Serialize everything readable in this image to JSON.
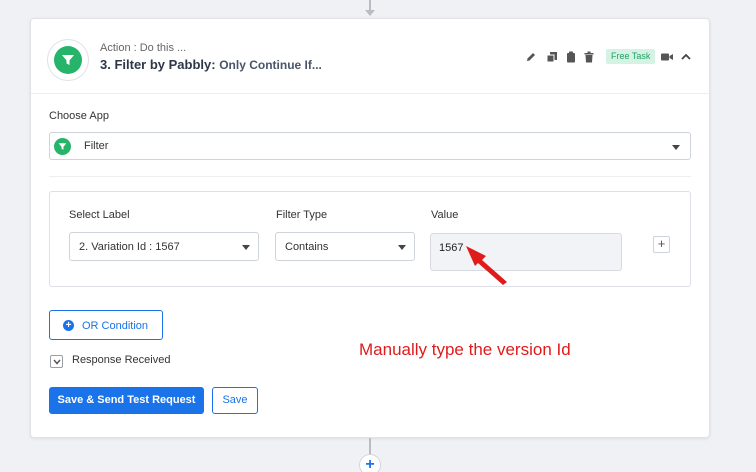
{
  "header": {
    "action_label": "Action : Do this ...",
    "step_title": "3. Filter by Pabbly:",
    "step_subtitle": "Only Continue If...",
    "badge": "Free Task",
    "icons": [
      "pencil-icon",
      "copy-icon",
      "clipboard-icon",
      "trash-icon",
      "video-icon",
      "chevron-up-icon"
    ]
  },
  "choose_app": {
    "label": "Choose App",
    "value": "Filter",
    "icon": "filter-icon"
  },
  "filter": {
    "select_label_heading": "Select Label",
    "select_label_value": "2. Variation Id : 1567",
    "filter_type_heading": "Filter Type",
    "filter_type_value": "Contains",
    "value_heading": "Value",
    "value_text": "1567",
    "add_button": "+"
  },
  "or_condition": {
    "label": "OR Condition"
  },
  "response": {
    "label": "Response Received"
  },
  "buttons": {
    "save_send": "Save & Send Test Request",
    "save": "Save"
  },
  "annotation": {
    "text": "Manually type the version Id",
    "color": "#e01b1b"
  },
  "colors": {
    "accent": "#1a73e8",
    "app_green": "#25b46a",
    "badge_bg": "#d4f3e4",
    "badge_text": "#22a064"
  }
}
